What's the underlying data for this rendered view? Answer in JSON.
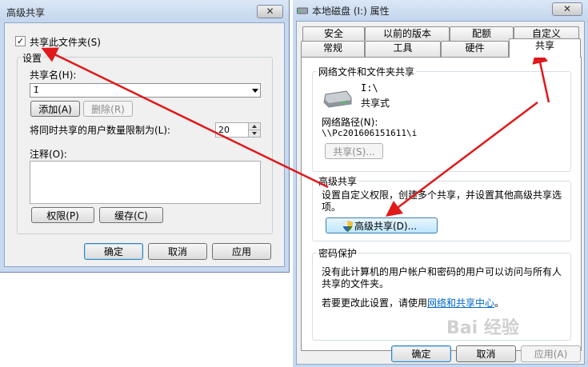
{
  "right_dialog": {
    "title": "本地磁盘 (I:) 属性",
    "close_label": "✕",
    "tabs_row1": [
      "安全",
      "以前的版本",
      "配额",
      "自定义"
    ],
    "tabs_row2": [
      "常规",
      "工具",
      "硬件",
      "共享"
    ],
    "network_share": {
      "group_title": "网络文件和文件夹共享",
      "drive_name": "I:\\",
      "share_type": "共享式",
      "network_path_label": "网络路径(N):",
      "network_path_value": "\\\\Pc20160615​1611\\i",
      "share_button": "共享(S)..."
    },
    "advanced_share": {
      "group_title": "高级共享",
      "description_line1": "设置自定义权限，创建多个共享，并设置其他高级共享选",
      "description_line2": "项。",
      "button": "高级共享(D)..."
    },
    "password": {
      "group_title": "密码保护",
      "line1": "没有此计算机的用户帐户和密码的用户可以访问与所有人",
      "line2": "共享的文件夹。",
      "line3_prefix": "若要更改此设置，请使用",
      "line3_link": "网络和共享中心",
      "line3_suffix": "。"
    },
    "buttons": {
      "ok": "确定",
      "cancel": "取消",
      "apply": "应用(A)"
    }
  },
  "left_dialog": {
    "title": "高级共享",
    "close_label": "✕",
    "share_checkbox": {
      "label": "共享此文件夹(S)",
      "checked": "✓"
    },
    "settings": {
      "group_title": "设置",
      "share_name_label": "共享名(H):",
      "share_name_value": "I",
      "add_button": "添加(A)",
      "remove_button": "删除(R)",
      "limit_label": "将同时共享的用户数量限制为(L):",
      "limit_value": "20",
      "comment_label": "注释(O):",
      "comment_value": "",
      "permissions_button": "权限(P)",
      "cache_button": "缓存(C)"
    },
    "buttons": {
      "ok": "确定",
      "cancel": "取消",
      "apply": "应用"
    }
  },
  "watermark": "Bai 经验",
  "colors": {
    "titlebar": "#c6d9f1",
    "client": "#f0f0f0",
    "arrow": "#e0191b",
    "link": "#0066cc"
  }
}
